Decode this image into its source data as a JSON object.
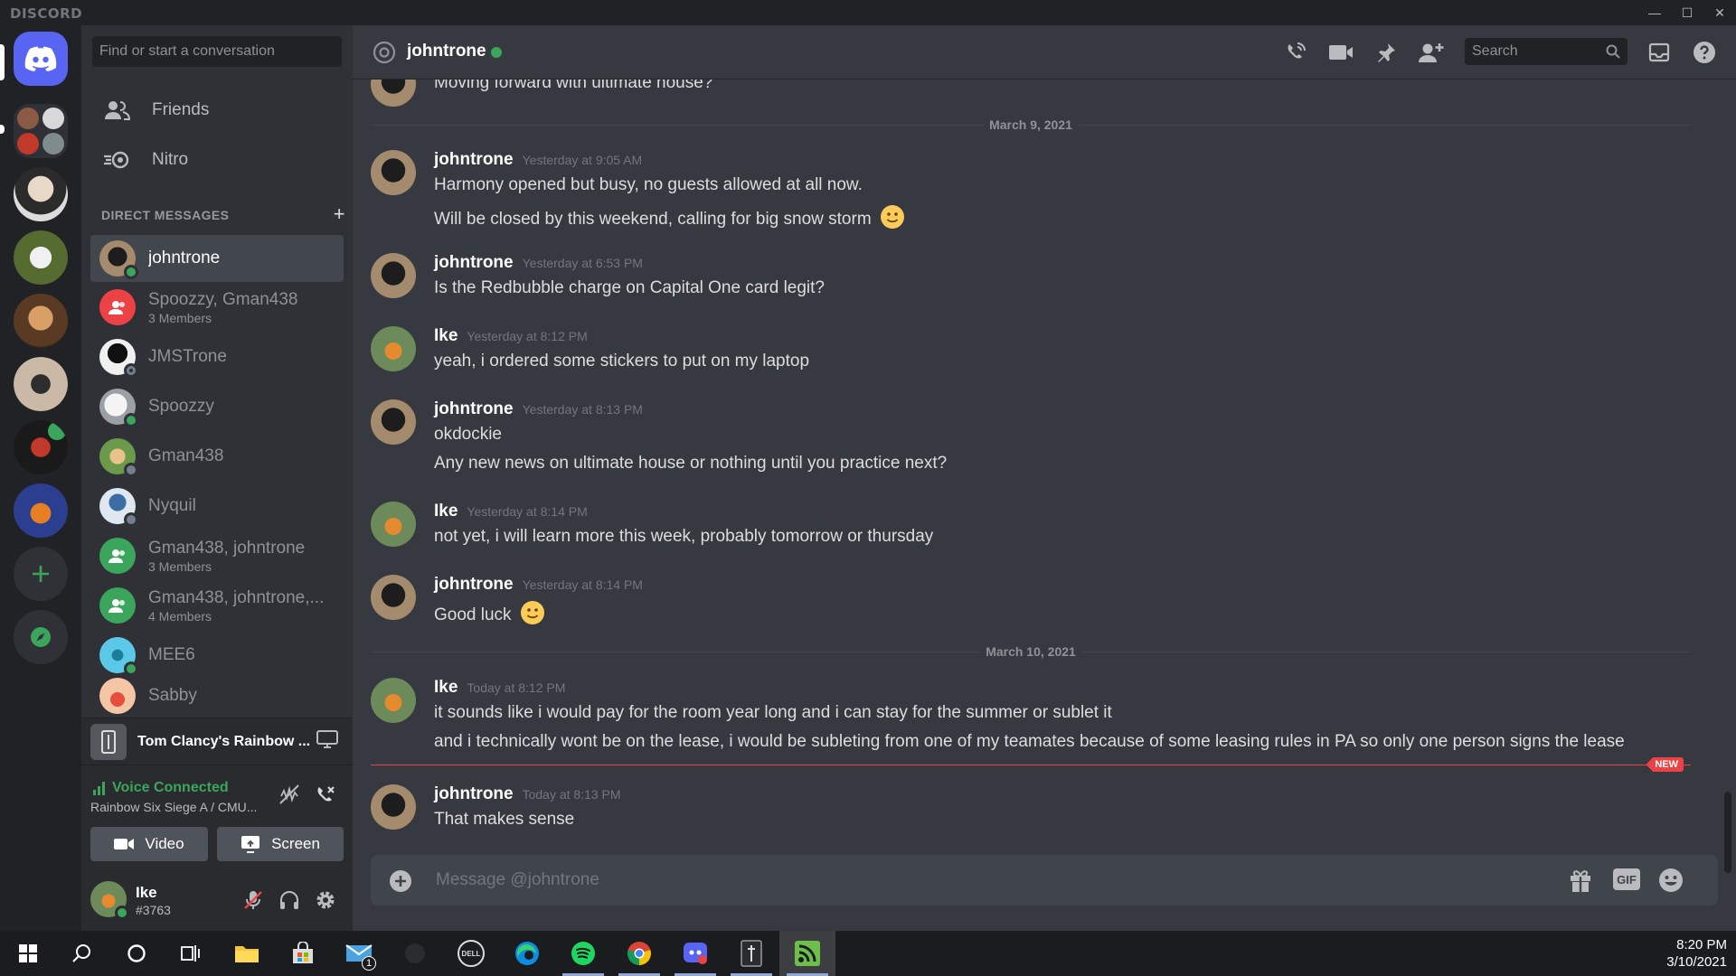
{
  "window": {
    "brand": "DISCORD",
    "minimize_glyph": "—",
    "maximize_glyph": "☐",
    "close_glyph": "✕"
  },
  "sidebar": {
    "search_placeholder": "Find or start a conversation",
    "nav": [
      {
        "label": "Friends",
        "icon": "friends-icon"
      },
      {
        "label": "Nitro",
        "icon": "nitro-icon"
      }
    ],
    "dm_header": "DIRECT MESSAGES",
    "dm_add": "+",
    "dms": [
      {
        "name": "johntrone",
        "status": "online",
        "active": true
      },
      {
        "name": "Spoozzy, Gman438",
        "sub": "3 Members",
        "group": true,
        "color": "#ed4245"
      },
      {
        "name": "JMSTrone",
        "status": "offline"
      },
      {
        "name": "Spoozzy",
        "status": "online"
      },
      {
        "name": "Gman438",
        "status": "offline"
      },
      {
        "name": "Nyquil",
        "status": "offline"
      },
      {
        "name": "Gman438, johntrone",
        "sub": "3 Members",
        "group": true,
        "color": "#3ba55c"
      },
      {
        "name": "Gman438, johntrone,...",
        "sub": "4 Members",
        "group": true,
        "color": "#3ba55c"
      },
      {
        "name": "MEE6",
        "status": "online"
      },
      {
        "name": "Sabby",
        "status": "none"
      }
    ]
  },
  "activity": {
    "game": "Tom Clancy's Rainbow ..."
  },
  "voice": {
    "status": "Voice Connected",
    "channel": "Rainbow Six Siege A / CMU...",
    "video_label": "Video",
    "screen_label": "Screen"
  },
  "user": {
    "name": "Ike",
    "tag": "#3763"
  },
  "chat": {
    "channel_name": "johntrone",
    "search_placeholder": "Search",
    "partial_message": "Moving forward with ultimate house?",
    "date_1": "March 9, 2021",
    "date_2": "March 10, 2021",
    "messages": [
      {
        "author": "johntrone",
        "time": "Yesterday at 9:05 AM",
        "lines": [
          "Harmony opened but busy, no guests allowed at all now.",
          "Will be closed by this weekend, calling for big snow storm"
        ]
      },
      {
        "author": "johntrone",
        "time": "Yesterday at 6:53 PM",
        "lines": [
          "Is the Redbubble charge on Capital One card legit?"
        ]
      },
      {
        "author": "Ike",
        "time": "Yesterday at 8:12 PM",
        "lines": [
          "yeah, i ordered some stickers to put on my laptop"
        ]
      },
      {
        "author": "johntrone",
        "time": "Yesterday at 8:13 PM",
        "lines": [
          "okdockie",
          "Any new news on ultimate house or nothing until you practice next?"
        ]
      },
      {
        "author": "Ike",
        "time": "Yesterday at 8:14 PM",
        "lines": [
          "not yet, i will learn more this week, probably tomorrow or thursday"
        ]
      },
      {
        "author": "johntrone",
        "time": "Yesterday at 8:14 PM",
        "lines": [
          "Good luck"
        ]
      },
      {
        "author": "Ike",
        "time": "Today at 8:12 PM",
        "lines": [
          "it sounds like i would pay for the room year long and i can stay for the summer or sublet it",
          "and i technically wont be on the lease, i would be subleting from one of my teamates because of some leasing rules in PA so only one person signs the lease"
        ]
      },
      {
        "author": "johntrone",
        "time": "Today at 8:13 PM",
        "lines": [
          "That makes sense"
        ]
      }
    ],
    "new_badge": "NEW",
    "composer_placeholder": "Message @johntrone",
    "gif_label": "GIF"
  },
  "taskbar": {
    "mail_badge": "1",
    "dell_label": "DELL",
    "time": "8:20 PM",
    "date": "3/10/2021"
  },
  "colors": {
    "blurple": "#5865f2",
    "online": "#3ba55c",
    "offline": "#747f8d",
    "danger": "#ed4245"
  }
}
